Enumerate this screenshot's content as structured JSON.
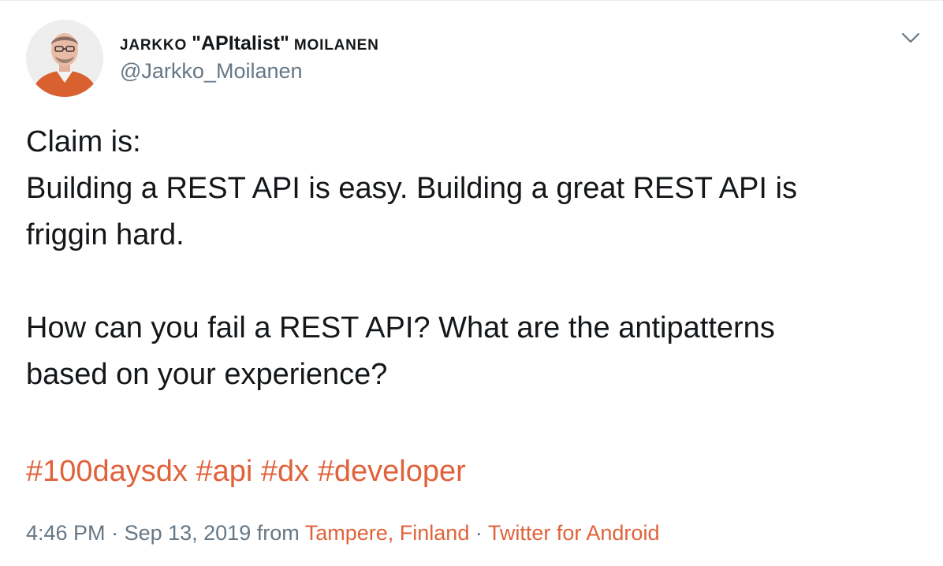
{
  "author": {
    "name_part1": "JARKKO ",
    "name_part2": "\"APItalist\"",
    "name_part3": " MOILANEN",
    "handle": "@Jarkko_Moilanen"
  },
  "tweet": {
    "lines": [
      "Claim is:",
      "Building a REST API is easy. Building a great REST API is",
      "friggin hard.",
      "How can you fail a REST API? What are the antipatterns",
      "based on your experience?"
    ],
    "hashtags": [
      "#100daysdx",
      "#api",
      "#dx",
      "#developer"
    ]
  },
  "meta": {
    "time": "4:46 PM",
    "sep1": " · ",
    "date": "Sep 13, 2019",
    "from": " from ",
    "location": "Tampere, Finland",
    "sep2": " · ",
    "source": "Twitter for Android"
  },
  "icons": {
    "menu": "chevron-down-icon"
  },
  "colors": {
    "link": "#e0623a",
    "secondary": "#657786",
    "text": "#14171a"
  }
}
